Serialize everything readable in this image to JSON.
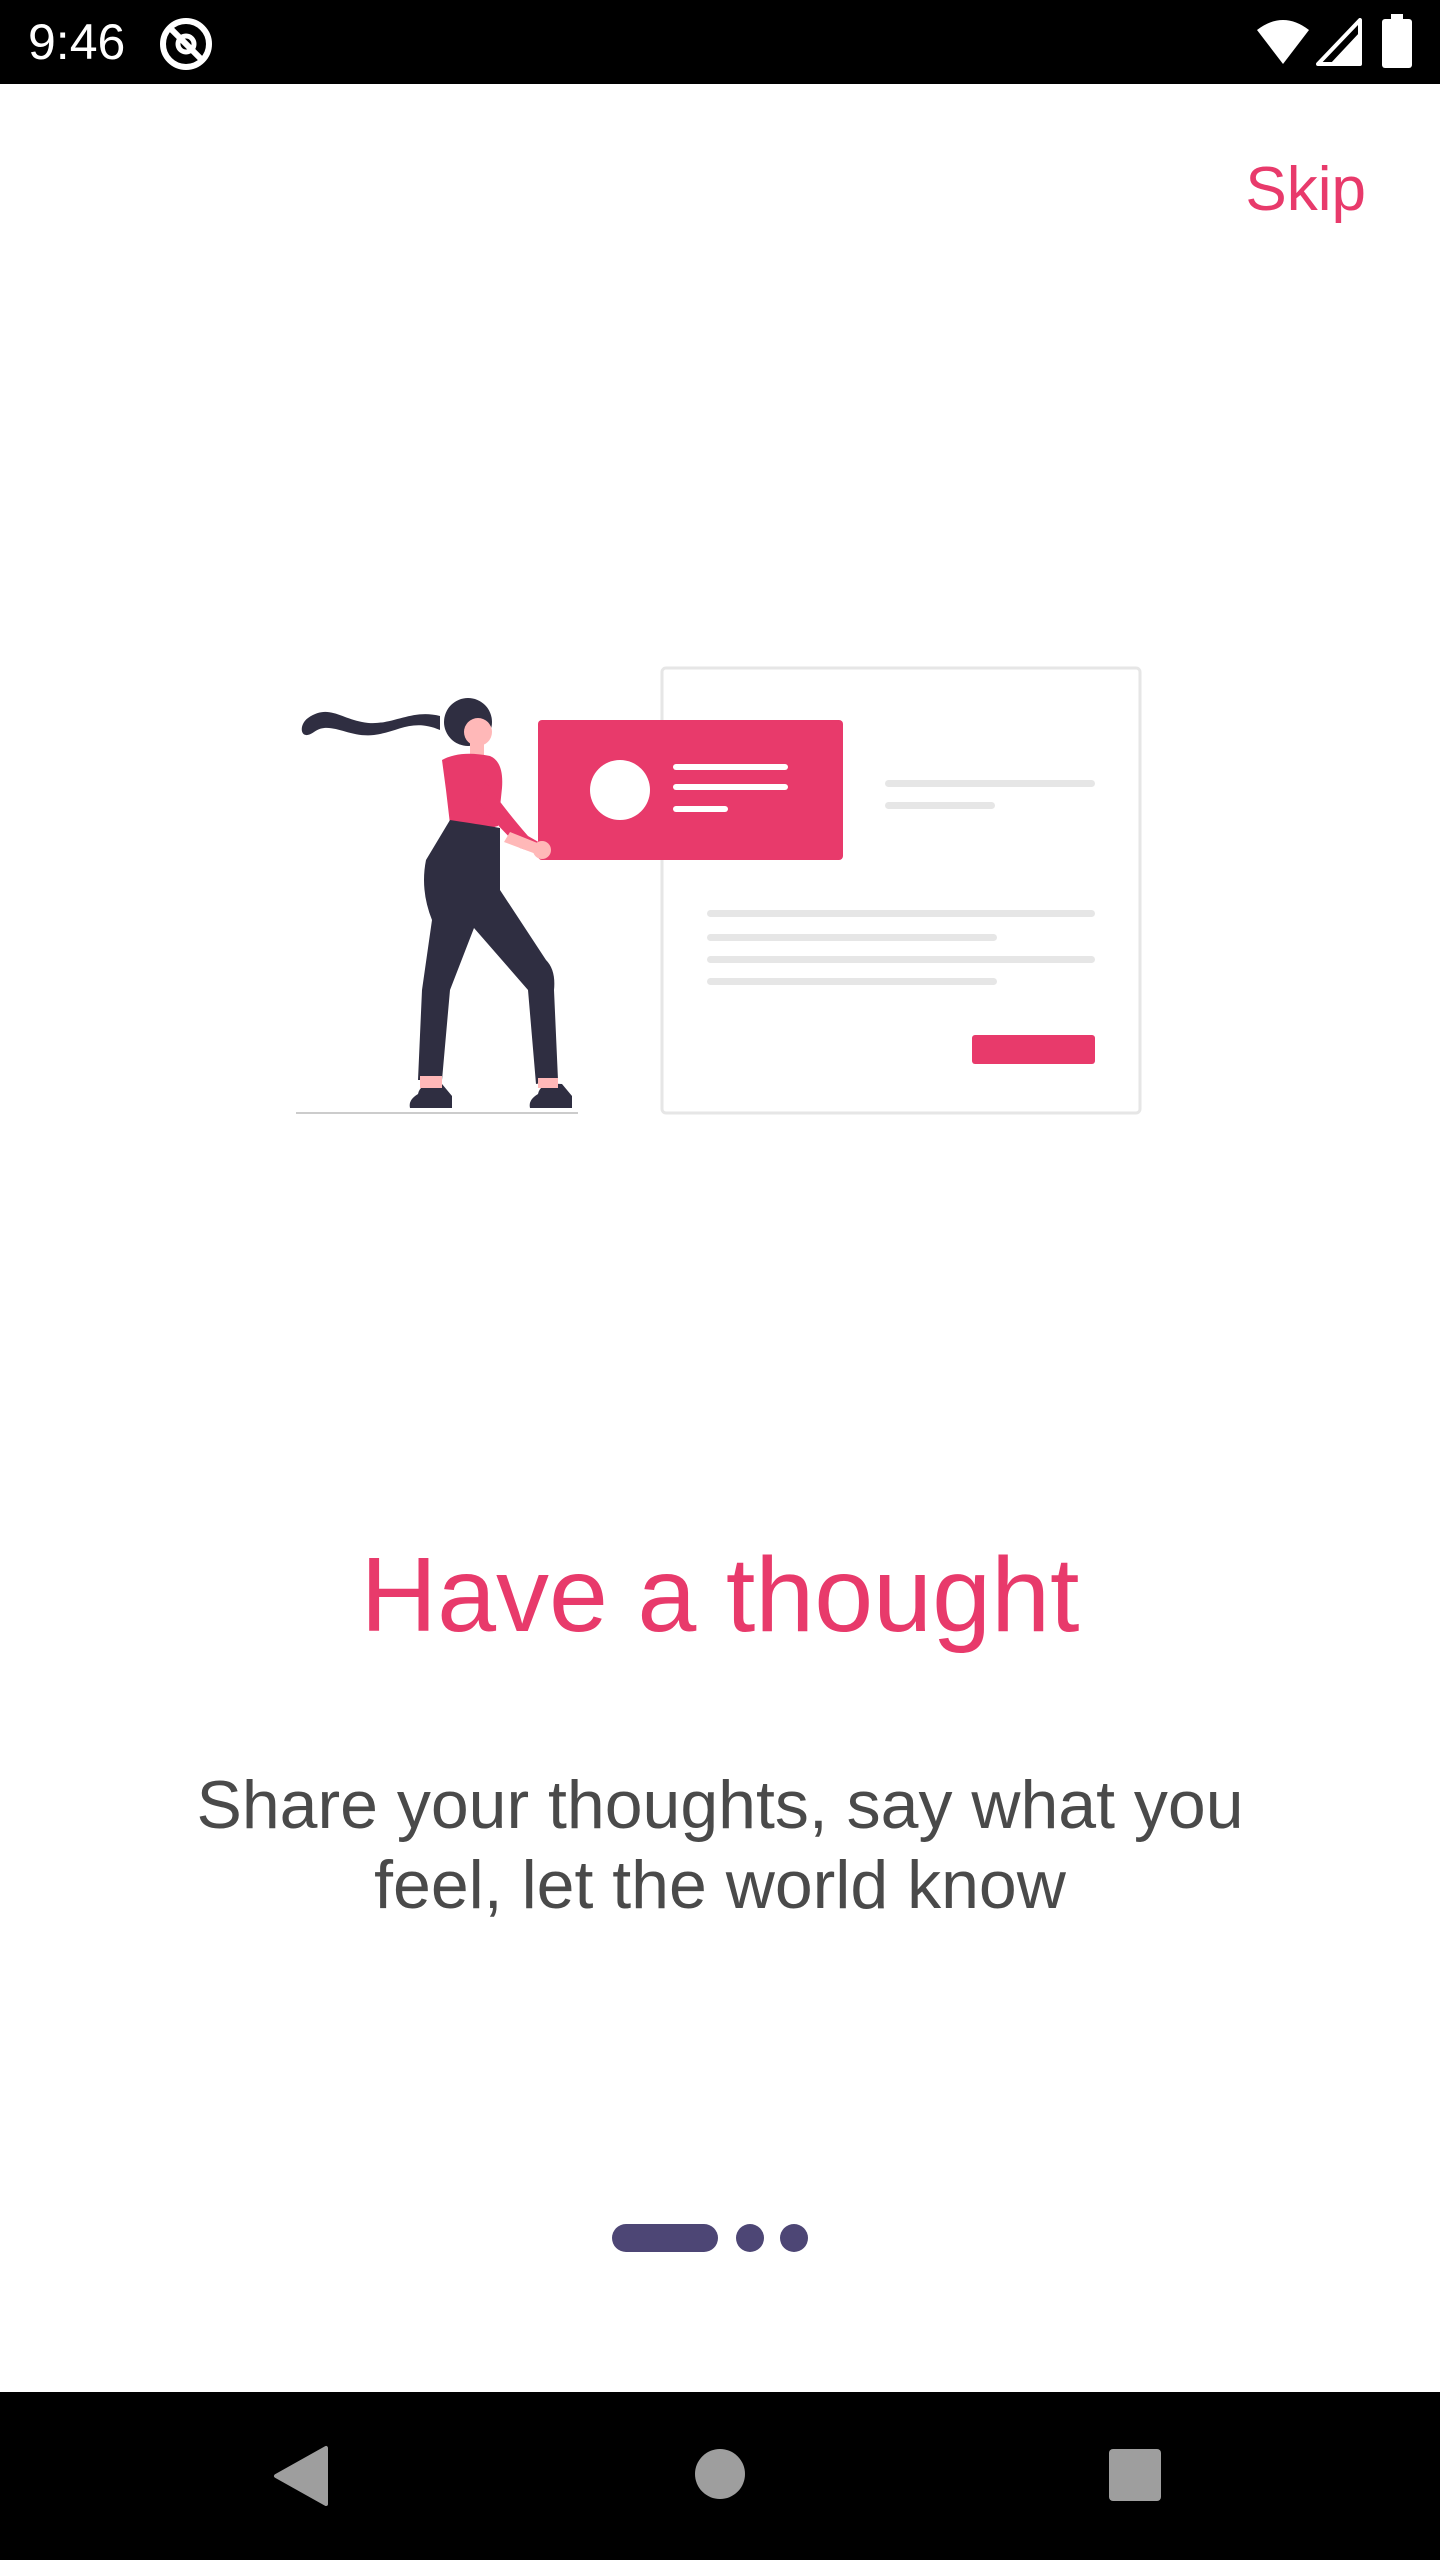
{
  "status_bar": {
    "time": "9:46",
    "icons": [
      "app-notification-icon",
      "wifi-icon",
      "cell-signal-icon",
      "battery-icon"
    ]
  },
  "skip_label": "Skip",
  "onboarding": {
    "title": "Have a thought",
    "description": "Share your thoughts, say what you feel, let the world know",
    "illustration": "woman-holding-card-illustration"
  },
  "page_indicator": {
    "total": 3,
    "active_index": 0
  },
  "nav_bar": {
    "icons": [
      "back-icon",
      "home-icon",
      "recents-icon"
    ]
  },
  "colors": {
    "accent": "#E83A6B",
    "indicator": "#4D4675",
    "text_body": "#4a4a4a",
    "illustration_dark": "#2F2E41",
    "illustration_skin": "#FFB8B8"
  }
}
